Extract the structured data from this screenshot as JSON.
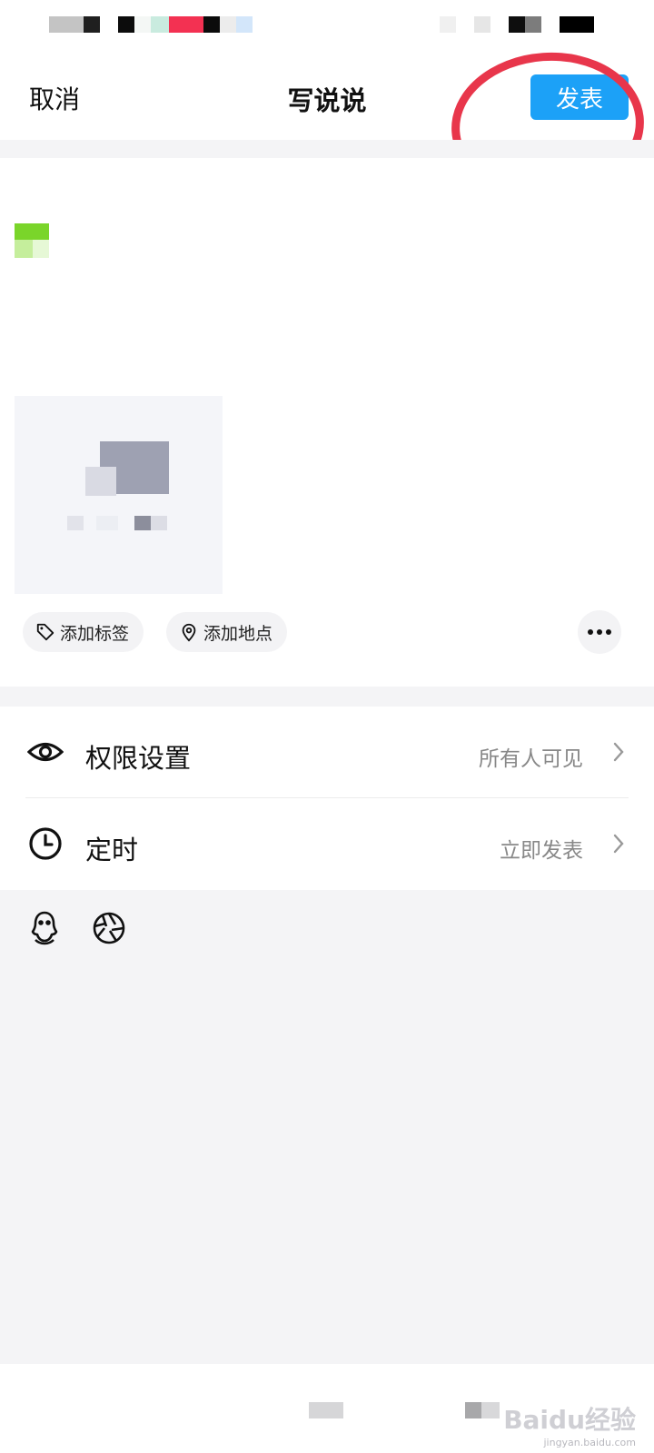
{
  "status_bar": {
    "blurred": true
  },
  "nav": {
    "cancel_label": "取消",
    "title": "写说说",
    "publish_label": "发表",
    "publish_color": "#1ca1f7",
    "highlight_color": "#e8364b"
  },
  "editor": {
    "chips": [
      {
        "icon": "tag-icon",
        "label": "添加标签"
      },
      {
        "icon": "location-pin-icon",
        "label": "添加地点"
      }
    ],
    "more_icon": "more-dots-icon"
  },
  "settings": {
    "permission": {
      "icon": "eye-icon",
      "label": "权限设置",
      "value": "所有人可见"
    },
    "timer": {
      "icon": "clock-icon",
      "label": "定时",
      "value": "立即发表"
    }
  },
  "share": {
    "icons": [
      "qq-penguin-icon",
      "aperture-icon"
    ]
  },
  "watermark": {
    "text": "Baidu经验",
    "subtext": "jingyan.baidu.com"
  }
}
